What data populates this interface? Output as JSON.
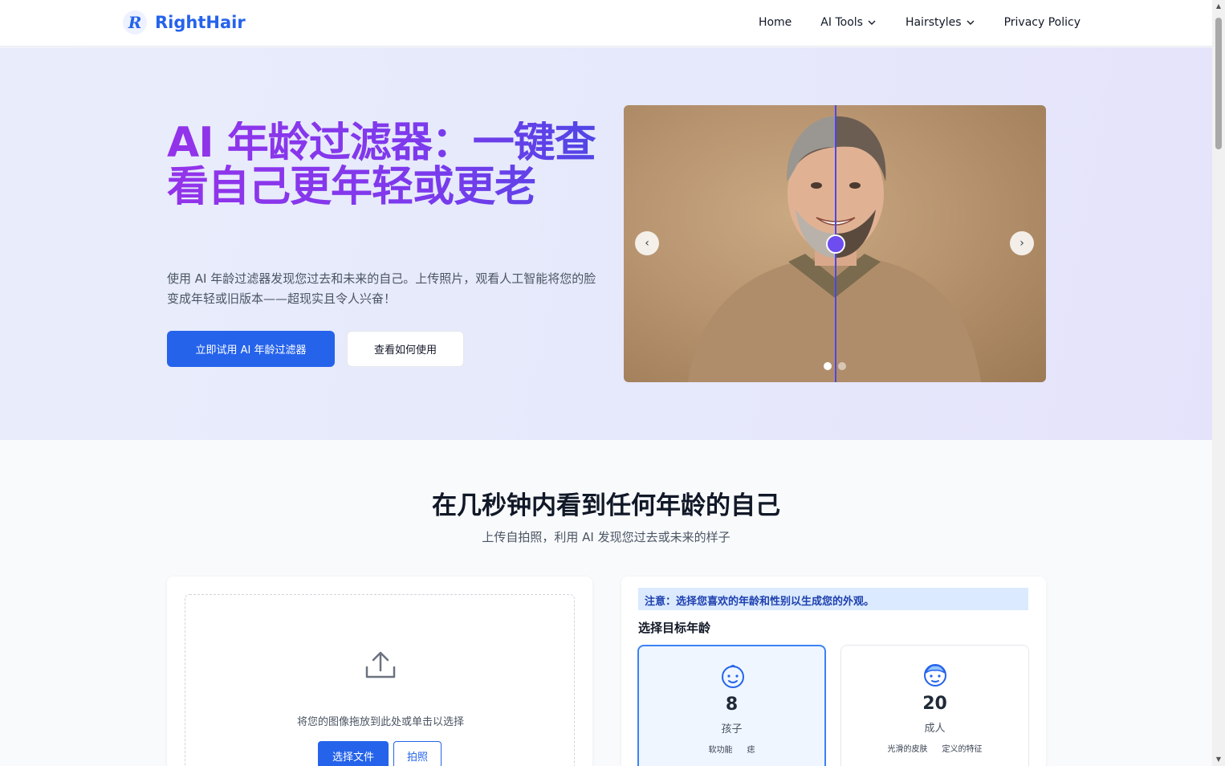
{
  "nav": {
    "logo_letter": "R",
    "brand": "RightHair",
    "links": [
      {
        "label": "Home"
      },
      {
        "label": "AI Tools"
      },
      {
        "label": "Hairstyles"
      },
      {
        "label": "Privacy Policy"
      }
    ]
  },
  "hero": {
    "title": "AI 年龄过滤器：一键查看自己更年轻或更老",
    "description": "使用 AI 年龄过滤器发现您过去和未来的自己。上传照片，观看人工智能将您的脸变成年轻或旧版本——超现实且令人兴奋！",
    "primary_button": "立即试用 AI 年龄过滤器",
    "secondary_button": "查看如何使用",
    "slider": {
      "prev_glyph": "‹",
      "next_glyph": "›",
      "dot_count": 2,
      "active_dot": 0
    }
  },
  "section": {
    "title": "在几秒钟内看到任何年龄的自己",
    "subtitle": "上传自拍照，利用 AI 发现您过去或未来的样子"
  },
  "upload": {
    "drop_text": "将您的图像拖放到此处或单击以选择",
    "choose_button": "选择文件",
    "photo_button": "拍照"
  },
  "age_panel": {
    "notice": "注意：选择您喜欢的年龄和性别以生成您的外观。",
    "label": "选择目标年龄",
    "options": [
      {
        "age": "8",
        "name": "孩子",
        "tags": [
          "软功能",
          "痣"
        ],
        "selected": true,
        "icon": "baby-face-icon"
      },
      {
        "age": "20",
        "name": "成人",
        "tags": [
          "光滑的皮肤",
          "定义的特征"
        ],
        "selected": false,
        "icon": "adult-face-icon"
      }
    ]
  },
  "colors": {
    "accent": "#2563eb",
    "title_gradient_start": "#9333ea",
    "title_gradient_end": "#4f46e5",
    "notice_bg": "#dbeafe"
  }
}
